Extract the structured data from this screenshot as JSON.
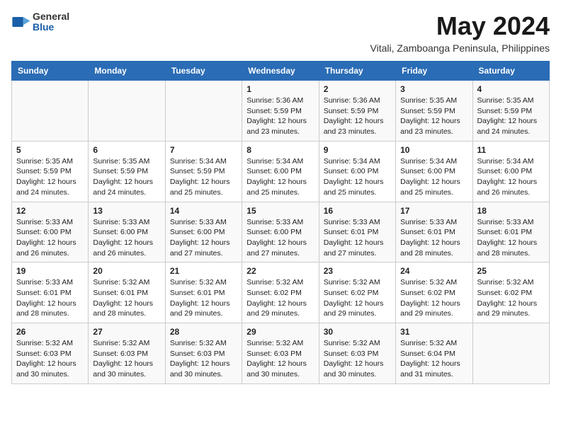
{
  "app": {
    "logo_general": "General",
    "logo_blue": "Blue"
  },
  "header": {
    "title": "May 2024",
    "subtitle": "Vitali, Zamboanga Peninsula, Philippines"
  },
  "calendar": {
    "weekdays": [
      "Sunday",
      "Monday",
      "Tuesday",
      "Wednesday",
      "Thursday",
      "Friday",
      "Saturday"
    ],
    "weeks": [
      {
        "days": [
          {
            "num": "",
            "info": ""
          },
          {
            "num": "",
            "info": ""
          },
          {
            "num": "",
            "info": ""
          },
          {
            "num": "1",
            "info": "Sunrise: 5:36 AM\nSunset: 5:59 PM\nDaylight: 12 hours\nand 23 minutes."
          },
          {
            "num": "2",
            "info": "Sunrise: 5:36 AM\nSunset: 5:59 PM\nDaylight: 12 hours\nand 23 minutes."
          },
          {
            "num": "3",
            "info": "Sunrise: 5:35 AM\nSunset: 5:59 PM\nDaylight: 12 hours\nand 23 minutes."
          },
          {
            "num": "4",
            "info": "Sunrise: 5:35 AM\nSunset: 5:59 PM\nDaylight: 12 hours\nand 24 minutes."
          }
        ]
      },
      {
        "days": [
          {
            "num": "5",
            "info": "Sunrise: 5:35 AM\nSunset: 5:59 PM\nDaylight: 12 hours\nand 24 minutes."
          },
          {
            "num": "6",
            "info": "Sunrise: 5:35 AM\nSunset: 5:59 PM\nDaylight: 12 hours\nand 24 minutes."
          },
          {
            "num": "7",
            "info": "Sunrise: 5:34 AM\nSunset: 5:59 PM\nDaylight: 12 hours\nand 25 minutes."
          },
          {
            "num": "8",
            "info": "Sunrise: 5:34 AM\nSunset: 6:00 PM\nDaylight: 12 hours\nand 25 minutes."
          },
          {
            "num": "9",
            "info": "Sunrise: 5:34 AM\nSunset: 6:00 PM\nDaylight: 12 hours\nand 25 minutes."
          },
          {
            "num": "10",
            "info": "Sunrise: 5:34 AM\nSunset: 6:00 PM\nDaylight: 12 hours\nand 25 minutes."
          },
          {
            "num": "11",
            "info": "Sunrise: 5:34 AM\nSunset: 6:00 PM\nDaylight: 12 hours\nand 26 minutes."
          }
        ]
      },
      {
        "days": [
          {
            "num": "12",
            "info": "Sunrise: 5:33 AM\nSunset: 6:00 PM\nDaylight: 12 hours\nand 26 minutes."
          },
          {
            "num": "13",
            "info": "Sunrise: 5:33 AM\nSunset: 6:00 PM\nDaylight: 12 hours\nand 26 minutes."
          },
          {
            "num": "14",
            "info": "Sunrise: 5:33 AM\nSunset: 6:00 PM\nDaylight: 12 hours\nand 27 minutes."
          },
          {
            "num": "15",
            "info": "Sunrise: 5:33 AM\nSunset: 6:00 PM\nDaylight: 12 hours\nand 27 minutes."
          },
          {
            "num": "16",
            "info": "Sunrise: 5:33 AM\nSunset: 6:01 PM\nDaylight: 12 hours\nand 27 minutes."
          },
          {
            "num": "17",
            "info": "Sunrise: 5:33 AM\nSunset: 6:01 PM\nDaylight: 12 hours\nand 28 minutes."
          },
          {
            "num": "18",
            "info": "Sunrise: 5:33 AM\nSunset: 6:01 PM\nDaylight: 12 hours\nand 28 minutes."
          }
        ]
      },
      {
        "days": [
          {
            "num": "19",
            "info": "Sunrise: 5:33 AM\nSunset: 6:01 PM\nDaylight: 12 hours\nand 28 minutes."
          },
          {
            "num": "20",
            "info": "Sunrise: 5:32 AM\nSunset: 6:01 PM\nDaylight: 12 hours\nand 28 minutes."
          },
          {
            "num": "21",
            "info": "Sunrise: 5:32 AM\nSunset: 6:01 PM\nDaylight: 12 hours\nand 29 minutes."
          },
          {
            "num": "22",
            "info": "Sunrise: 5:32 AM\nSunset: 6:02 PM\nDaylight: 12 hours\nand 29 minutes."
          },
          {
            "num": "23",
            "info": "Sunrise: 5:32 AM\nSunset: 6:02 PM\nDaylight: 12 hours\nand 29 minutes."
          },
          {
            "num": "24",
            "info": "Sunrise: 5:32 AM\nSunset: 6:02 PM\nDaylight: 12 hours\nand 29 minutes."
          },
          {
            "num": "25",
            "info": "Sunrise: 5:32 AM\nSunset: 6:02 PM\nDaylight: 12 hours\nand 29 minutes."
          }
        ]
      },
      {
        "days": [
          {
            "num": "26",
            "info": "Sunrise: 5:32 AM\nSunset: 6:03 PM\nDaylight: 12 hours\nand 30 minutes."
          },
          {
            "num": "27",
            "info": "Sunrise: 5:32 AM\nSunset: 6:03 PM\nDaylight: 12 hours\nand 30 minutes."
          },
          {
            "num": "28",
            "info": "Sunrise: 5:32 AM\nSunset: 6:03 PM\nDaylight: 12 hours\nand 30 minutes."
          },
          {
            "num": "29",
            "info": "Sunrise: 5:32 AM\nSunset: 6:03 PM\nDaylight: 12 hours\nand 30 minutes."
          },
          {
            "num": "30",
            "info": "Sunrise: 5:32 AM\nSunset: 6:03 PM\nDaylight: 12 hours\nand 30 minutes."
          },
          {
            "num": "31",
            "info": "Sunrise: 5:32 AM\nSunset: 6:04 PM\nDaylight: 12 hours\nand 31 minutes."
          },
          {
            "num": "",
            "info": ""
          }
        ]
      }
    ]
  }
}
